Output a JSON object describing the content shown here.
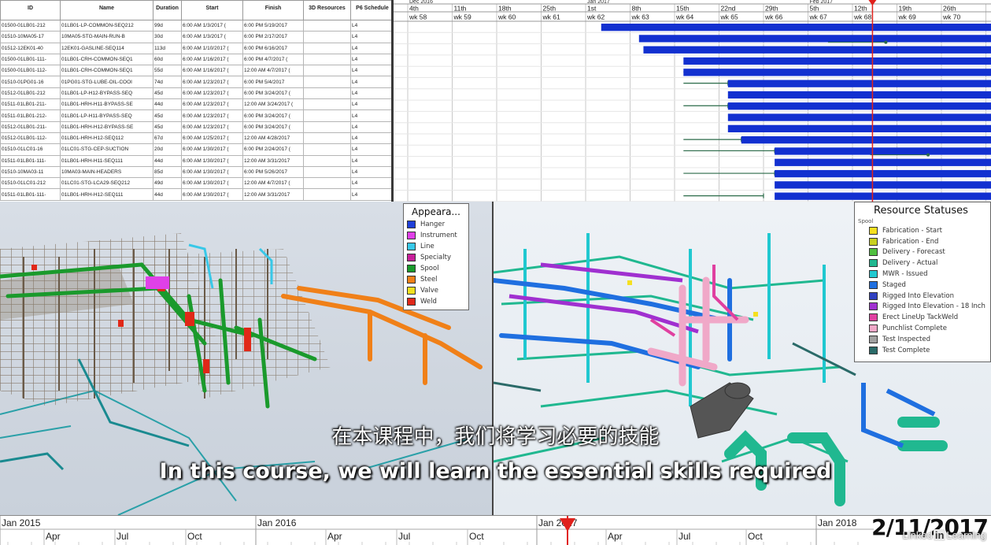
{
  "schedule": {
    "columns": [
      {
        "key": "id",
        "label": "ID"
      },
      {
        "key": "name",
        "label": "Name"
      },
      {
        "key": "duration",
        "label": "Duration"
      },
      {
        "key": "start",
        "label": "Start"
      },
      {
        "key": "finish",
        "label": "Finish"
      },
      {
        "key": "resources",
        "label": "3D Resources"
      },
      {
        "key": "p6",
        "label": "P6 Schedule"
      }
    ],
    "rows": [
      {
        "id": "01500-01LB01-212",
        "name": "01LB01-LP-COMMON-SEQ212",
        "duration": "99d",
        "start": "6:00 AM 1/3/2017 (",
        "finish": "6:00 PM 5/19/2017",
        "resources": "",
        "p6": "L4"
      },
      {
        "id": "01510-10MA05-17",
        "name": "10MA05-STG-MAIN-RUN-B",
        "duration": "30d",
        "start": "6:00 AM 1/3/2017 (",
        "finish": "6:00 PM 2/17/2017",
        "resources": "",
        "p6": "L4"
      },
      {
        "id": "01512-12EK01-40",
        "name": "12EK01-GASLINE-SEQ114",
        "duration": "113d",
        "start": "6:00 AM 1/10/2017 (",
        "finish": "6:00 PM 6/16/2017",
        "resources": "",
        "p6": "L4"
      },
      {
        "id": "01500-01LB01-111-",
        "name": "01LB01-CRH-COMMON-SEQ1",
        "duration": "60d",
        "start": "6:00 AM 1/16/2017 (",
        "finish": "6:00 PM 4/7/2017 (",
        "resources": "",
        "p6": "L4"
      },
      {
        "id": "01500-01LB01-112-",
        "name": "01LB01-CRH-COMMON-SEQ1",
        "duration": "55d",
        "start": "6:00 AM 1/16/2017 (",
        "finish": "12:00 AM 4/7/2017 (",
        "resources": "",
        "p6": "L4"
      },
      {
        "id": "01510-01PG01-16",
        "name": "01PG01-STG-LUBE-OIL-COOI",
        "duration": "74d",
        "start": "6:00 AM 1/23/2017 (",
        "finish": "6:00 PM 5/4/2017",
        "resources": "",
        "p6": "L4"
      },
      {
        "id": "01512-01LB01-212",
        "name": "01LB01-LP-H12-BYPASS-SEQ",
        "duration": "45d",
        "start": "6:00 AM 1/23/2017 (",
        "finish": "6:00 PM 3/24/2017 (",
        "resources": "",
        "p6": "L4"
      },
      {
        "id": "01511-01LB01-211-",
        "name": "01LB01-HRH-H11-BYPASS-SE",
        "duration": "44d",
        "start": "6:00 AM 1/23/2017 (",
        "finish": "12:00 AM 3/24/2017 (",
        "resources": "",
        "p6": "L4"
      },
      {
        "id": "01511-01LB01-212-",
        "name": "01LB01-LP-H11-BYPASS-SEQ",
        "duration": "45d",
        "start": "6:00 AM 1/23/2017 (",
        "finish": "6:00 PM 3/24/2017 (",
        "resources": "",
        "p6": "L4"
      },
      {
        "id": "01512-01LB01-211-",
        "name": "01LB01-HRH-H12-BYPASS-SE",
        "duration": "45d",
        "start": "6:00 AM 1/23/2017 (",
        "finish": "6:00 PM 3/24/2017 (",
        "resources": "",
        "p6": "L4"
      },
      {
        "id": "01512-01LB01-112-",
        "name": "01LB01-HRH-H12-SEQ112",
        "duration": "67d",
        "start": "6:00 AM 1/25/2017 (",
        "finish": "12:00 AM 4/28/2017",
        "resources": "",
        "p6": "L4"
      },
      {
        "id": "01510-01LC01-16",
        "name": "01LC01-STG-CEP-SUCTION",
        "duration": "20d",
        "start": "6:00 AM 1/30/2017 (",
        "finish": "6:00 PM 2/24/2017 (",
        "resources": "",
        "p6": "L4"
      },
      {
        "id": "01511-01LB01-111-",
        "name": "01LB01-HRH-H11-SEQ111",
        "duration": "44d",
        "start": "6:00 AM 1/30/2017 (",
        "finish": "12:00 AM 3/31/2017",
        "resources": "",
        "p6": "L4"
      },
      {
        "id": "01510-10MA03-11",
        "name": "10MA03-MAIN-HEADERS",
        "duration": "85d",
        "start": "6:00 AM 1/30/2017 (",
        "finish": "6:00 PM 5/26/2017",
        "resources": "",
        "p6": "L4"
      },
      {
        "id": "01510-01LC01-212",
        "name": "01LC01-STG-LCA29-SEQ212",
        "duration": "49d",
        "start": "6:00 AM 1/30/2017 (",
        "finish": "12:00 AM 4/7/2017 (",
        "resources": "",
        "p6": "L4"
      },
      {
        "id": "01511-01LB01-111-",
        "name": "01LB01-HRH-H12-SEQ111",
        "duration": "44d",
        "start": "6:00 AM 1/30/2017 (",
        "finish": "12:00 AM 3/31/2017",
        "resources": "",
        "p6": "L4"
      }
    ]
  },
  "gantt": {
    "months": [
      {
        "label": "Dec 2016",
        "col": 0
      },
      {
        "label": "Jan 2017",
        "col": 4
      },
      {
        "label": "Feb 2017",
        "col": 9
      }
    ],
    "days": [
      "4th",
      "11th",
      "18th",
      "25th",
      "1st",
      "8th",
      "15th",
      "22nd",
      "29th",
      "5th",
      "12th",
      "19th",
      "26th"
    ],
    "weeks": [
      "wk 58",
      "wk 59",
      "wk 60",
      "wk 61",
      "wk 62",
      "wk 63",
      "wk 64",
      "wk 65",
      "wk 66",
      "wk 67",
      "wk 68",
      "wk 69",
      "wk 70"
    ],
    "bars": [
      {
        "start": 4.35,
        "dot": null
      },
      {
        "start": 5.2,
        "dot": 10.75
      },
      {
        "start": 5.3,
        "dot": null
      },
      {
        "start": 6.2,
        "dot": null
      },
      {
        "start": 6.2,
        "dot": null
      },
      {
        "start": 7.2,
        "dot": null
      },
      {
        "start": 7.2,
        "dot": null
      },
      {
        "start": 7.2,
        "dot": null
      },
      {
        "start": 7.2,
        "dot": null
      },
      {
        "start": 7.2,
        "dot": null
      },
      {
        "start": 7.5,
        "dot": null
      },
      {
        "start": 8.25,
        "dot": 11.7
      },
      {
        "start": 8.25,
        "dot": null
      },
      {
        "start": 8.25,
        "dot": null
      },
      {
        "start": 8.25,
        "dot": null
      },
      {
        "start": 8.25,
        "dot": null
      }
    ],
    "links": [
      {
        "from": 6.2,
        "to": 7.0,
        "row": 4
      },
      {
        "from": 6.2,
        "to": 7.2,
        "row": 5
      },
      {
        "from": 6.2,
        "to": 7.2,
        "row": 7
      },
      {
        "from": 6.2,
        "to": 7.5,
        "row": 10
      },
      {
        "from": 6.2,
        "to": 8.25,
        "row": 11
      },
      {
        "from": 6.2,
        "to": 8.25,
        "row": 13
      },
      {
        "from": 6.2,
        "to": 8.0,
        "row": 15
      }
    ],
    "today": 10.45,
    "today_color": "#e0201b",
    "bar_color": "#1230d0"
  },
  "appearance_legend": {
    "title": "Appeara...",
    "items": [
      {
        "label": "Hanger",
        "color": "#1f3fd8"
      },
      {
        "label": "Instrument",
        "color": "#e040e8"
      },
      {
        "label": "Line",
        "color": "#38c8e8"
      },
      {
        "label": "Specialty",
        "color": "#c8209a"
      },
      {
        "label": "Spool",
        "color": "#1a9a2c"
      },
      {
        "label": "Steel",
        "color": "#f08018"
      },
      {
        "label": "Valve",
        "color": "#f0e020"
      },
      {
        "label": "Weld",
        "color": "#e02818"
      }
    ]
  },
  "status_legend": {
    "title": "Resource Statuses",
    "subtitle": "Spool",
    "items": [
      {
        "label": "Fabrication - Start",
        "color": "#f5e020"
      },
      {
        "label": "Fabrication - End",
        "color": "#c8d020"
      },
      {
        "label": "Delivery - Forecast",
        "color": "#50c040"
      },
      {
        "label": "Delivery - Actual",
        "color": "#20b890"
      },
      {
        "label": "MWR - Issued",
        "color": "#20c8d0"
      },
      {
        "label": "Staged",
        "color": "#1f6fe0"
      },
      {
        "label": "Rigged Into Elevation",
        "color": "#3040c0"
      },
      {
        "label": "Rigged Into Elevation - 18 Inch",
        "color": "#a030d0"
      },
      {
        "label": "Erect LineUp TackWeld",
        "color": "#e040a0"
      },
      {
        "label": "Punchlist Complete",
        "color": "#f0a8c8"
      },
      {
        "label": "Test Inspected",
        "color": "#a0a0a0"
      },
      {
        "label": "Test Complete",
        "color": "#2a6a68"
      }
    ]
  },
  "timeline": {
    "years": [
      "Jan 2015",
      "Jan 2016",
      "Jan 2017",
      "Jan 2018"
    ],
    "months": [
      "Apr",
      "Jul",
      "Oct",
      "Apr",
      "Jul",
      "Oct",
      "Apr",
      "Jul",
      "Oct"
    ],
    "current_date": "2/11/2017",
    "marker_color": "#e0201b"
  },
  "subtitles": {
    "chinese": "在本课程中，我们将学习必要的技能",
    "english": "In this course, we will learn the essential skills required"
  },
  "watermark": {
    "prefix": "Linked",
    "mark": "in",
    "suffix": "Learning"
  }
}
